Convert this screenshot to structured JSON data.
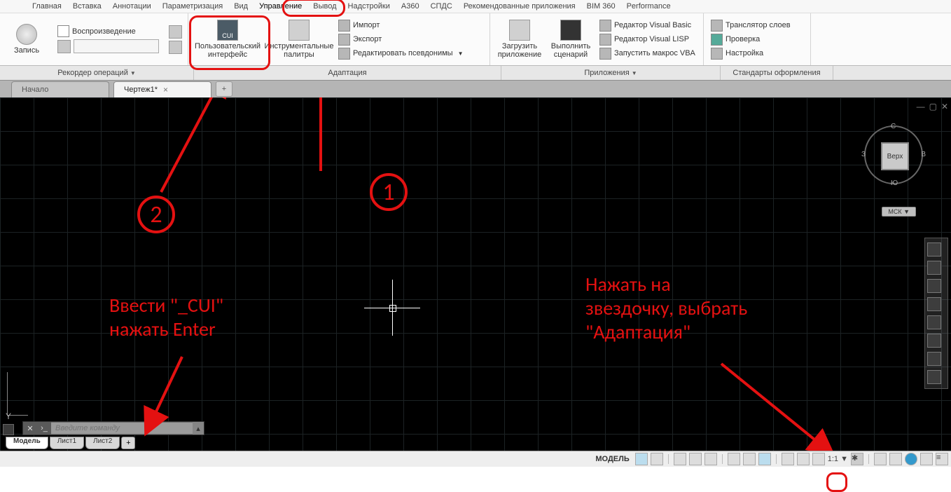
{
  "menu": [
    "Главная",
    "Вставка",
    "Аннотации",
    "Параметризация",
    "Вид",
    "Управление",
    "Вывод",
    "Надстройки",
    "A360",
    "СПДС",
    "Рекомендованные приложения",
    "BIM 360",
    "Performance"
  ],
  "active_menu": "Управление",
  "ribbon": {
    "recorder": {
      "big": "Запись",
      "play": "Воспроизведение",
      "footer": "Рекордер операций"
    },
    "adapt": {
      "cui": "Пользовательский интерфейс",
      "palettes": "Инструментальные палитры",
      "rows": [
        "Импорт",
        "Экспорт",
        "Редактировать псевдонимы"
      ],
      "footer": "Адаптация"
    },
    "apps": {
      "load": "Загрузить приложение",
      "run": "Выполнить сценарий",
      "rows": [
        "Редактор Visual Basic",
        "Редактор Visual LISP",
        "Запустить макрос VBA"
      ],
      "footer": "Приложения"
    },
    "std": {
      "rows": [
        "Транслятор слоев",
        "Проверка",
        "Настройка"
      ],
      "footer": "Стандарты оформления"
    }
  },
  "tabs": {
    "start": "Начало",
    "drawing": "Чертеж1*"
  },
  "viewcube": {
    "face": "Верх",
    "n": "С",
    "s": "Ю",
    "e": "В",
    "w": "З",
    "msk": "МСК"
  },
  "cmd_placeholder": "Введите команду",
  "layout_tabs": [
    "Модель",
    "Лист1",
    "Лист2"
  ],
  "status_model": "МОДЕЛЬ",
  "status_scale": "1:1",
  "annotations": {
    "n1": "1",
    "n2": "2",
    "left_text_l1": "Ввести \"_CUI\"",
    "left_text_l2": "нажать Enter",
    "right_text_l1": "Нажать на",
    "right_text_l2": "звездочку, выбрать",
    "right_text_l3": "\"Адаптация\""
  }
}
